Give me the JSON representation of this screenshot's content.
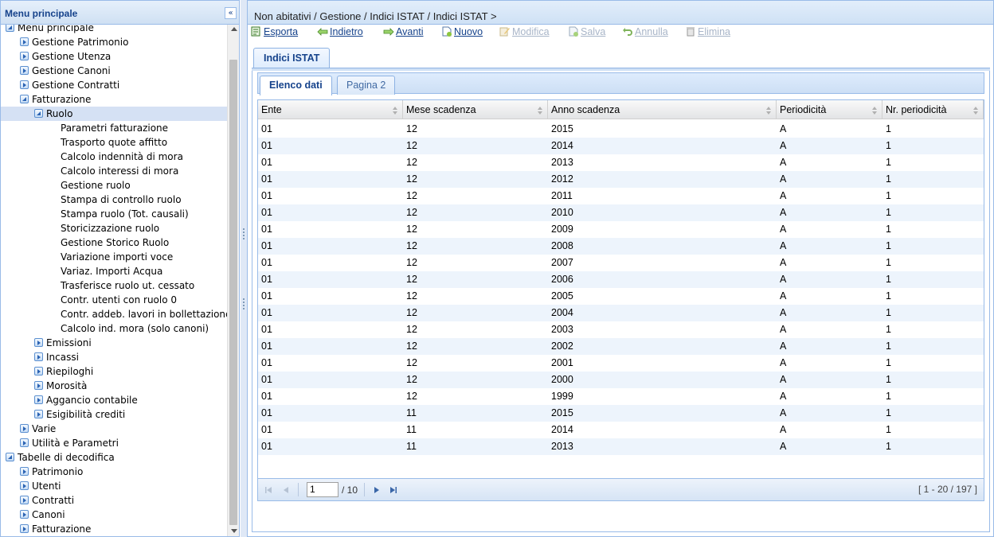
{
  "left_panel": {
    "title": "Menu principale",
    "tree": [
      {
        "label": "Menu principale",
        "level": 0,
        "state": "expanded",
        "selected": false
      },
      {
        "label": "Gestione Patrimonio",
        "level": 1,
        "state": "collapsed",
        "selected": false
      },
      {
        "label": "Gestione Utenza",
        "level": 1,
        "state": "collapsed",
        "selected": false
      },
      {
        "label": "Gestione Canoni",
        "level": 1,
        "state": "collapsed",
        "selected": false
      },
      {
        "label": "Gestione Contratti",
        "level": 1,
        "state": "collapsed",
        "selected": false
      },
      {
        "label": "Fatturazione",
        "level": 1,
        "state": "expanded",
        "selected": false
      },
      {
        "label": "Ruolo",
        "level": 2,
        "state": "expanded",
        "selected": true
      },
      {
        "label": "Parametri fatturazione",
        "level": 3,
        "state": "leaf",
        "selected": false
      },
      {
        "label": "Trasporto quote affitto",
        "level": 3,
        "state": "leaf",
        "selected": false
      },
      {
        "label": "Calcolo indennità di mora",
        "level": 3,
        "state": "leaf",
        "selected": false
      },
      {
        "label": "Calcolo interessi di mora",
        "level": 3,
        "state": "leaf",
        "selected": false
      },
      {
        "label": "Gestione ruolo",
        "level": 3,
        "state": "leaf",
        "selected": false
      },
      {
        "label": "Stampa di controllo ruolo",
        "level": 3,
        "state": "leaf",
        "selected": false
      },
      {
        "label": "Stampa ruolo (Tot. causali)",
        "level": 3,
        "state": "leaf",
        "selected": false
      },
      {
        "label": "Storicizzazione ruolo",
        "level": 3,
        "state": "leaf",
        "selected": false
      },
      {
        "label": "Gestione Storico Ruolo",
        "level": 3,
        "state": "leaf",
        "selected": false
      },
      {
        "label": "Variazione importi voce",
        "level": 3,
        "state": "leaf",
        "selected": false
      },
      {
        "label": "Variaz. Importi Acqua",
        "level": 3,
        "state": "leaf",
        "selected": false
      },
      {
        "label": "Trasferisce ruolo ut. cessato",
        "level": 3,
        "state": "leaf",
        "selected": false
      },
      {
        "label": "Contr. utenti con ruolo 0",
        "level": 3,
        "state": "leaf",
        "selected": false
      },
      {
        "label": "Contr. addeb. lavori in bollettazione",
        "level": 3,
        "state": "leaf",
        "selected": false
      },
      {
        "label": "Calcolo ind. mora (solo canoni)",
        "level": 3,
        "state": "leaf",
        "selected": false
      },
      {
        "label": "Emissioni",
        "level": 2,
        "state": "collapsed",
        "selected": false
      },
      {
        "label": "Incassi",
        "level": 2,
        "state": "collapsed",
        "selected": false
      },
      {
        "label": "Riepiloghi",
        "level": 2,
        "state": "collapsed",
        "selected": false
      },
      {
        "label": "Morosità",
        "level": 2,
        "state": "collapsed",
        "selected": false
      },
      {
        "label": "Aggancio contabile",
        "level": 2,
        "state": "collapsed",
        "selected": false
      },
      {
        "label": "Esigibilità crediti",
        "level": 2,
        "state": "collapsed",
        "selected": false
      },
      {
        "label": "Varie",
        "level": 1,
        "state": "collapsed",
        "selected": false
      },
      {
        "label": "Utilità e Parametri",
        "level": 1,
        "state": "collapsed",
        "selected": false
      },
      {
        "label": "Tabelle di decodifica",
        "level": 0,
        "state": "expanded",
        "selected": false
      },
      {
        "label": "Patrimonio",
        "level": 1,
        "state": "collapsed",
        "selected": false
      },
      {
        "label": "Utenti",
        "level": 1,
        "state": "collapsed",
        "selected": false
      },
      {
        "label": "Contratti",
        "level": 1,
        "state": "collapsed",
        "selected": false
      },
      {
        "label": "Canoni",
        "level": 1,
        "state": "collapsed",
        "selected": false
      },
      {
        "label": "Fatturazione",
        "level": 1,
        "state": "collapsed",
        "selected": false
      }
    ]
  },
  "breadcrumb": "Non abitativi / Gestione / Indici ISTAT / Indici ISTAT >",
  "toolbar": {
    "esporta": "Esporta",
    "indietro": "Indietro",
    "avanti": "Avanti",
    "nuovo": "Nuovo",
    "modifica": "Modifica",
    "salva": "Salva",
    "annulla": "Annulla",
    "elimina": "Elimina"
  },
  "outer_tab": "Indici ISTAT",
  "inner_tabs": [
    "Elenco dati",
    "Pagina 2"
  ],
  "grid": {
    "columns": [
      "Ente",
      "Mese scadenza",
      "Anno scadenza",
      "Periodicità",
      "Nr. periodicità"
    ],
    "rows": [
      [
        "01",
        "12",
        "2015",
        "A",
        "1"
      ],
      [
        "01",
        "12",
        "2014",
        "A",
        "1"
      ],
      [
        "01",
        "12",
        "2013",
        "A",
        "1"
      ],
      [
        "01",
        "12",
        "2012",
        "A",
        "1"
      ],
      [
        "01",
        "12",
        "2011",
        "A",
        "1"
      ],
      [
        "01",
        "12",
        "2010",
        "A",
        "1"
      ],
      [
        "01",
        "12",
        "2009",
        "A",
        "1"
      ],
      [
        "01",
        "12",
        "2008",
        "A",
        "1"
      ],
      [
        "01",
        "12",
        "2007",
        "A",
        "1"
      ],
      [
        "01",
        "12",
        "2006",
        "A",
        "1"
      ],
      [
        "01",
        "12",
        "2005",
        "A",
        "1"
      ],
      [
        "01",
        "12",
        "2004",
        "A",
        "1"
      ],
      [
        "01",
        "12",
        "2003",
        "A",
        "1"
      ],
      [
        "01",
        "12",
        "2002",
        "A",
        "1"
      ],
      [
        "01",
        "12",
        "2001",
        "A",
        "1"
      ],
      [
        "01",
        "12",
        "2000",
        "A",
        "1"
      ],
      [
        "01",
        "12",
        "1999",
        "A",
        "1"
      ],
      [
        "01",
        "11",
        "2015",
        "A",
        "1"
      ],
      [
        "01",
        "11",
        "2014",
        "A",
        "1"
      ],
      [
        "01",
        "11",
        "2013",
        "A",
        "1"
      ]
    ]
  },
  "pager": {
    "current_page": "1",
    "total_pages": "/ 10",
    "info": "[ 1 - 20 / 197 ]"
  },
  "colors": {
    "panel_border": "#99bbe8",
    "header_text": "#15428b",
    "row_alt": "#edf4fc",
    "selected_node": "#d5e1f4",
    "disabled_text": "#a8b5c8"
  }
}
